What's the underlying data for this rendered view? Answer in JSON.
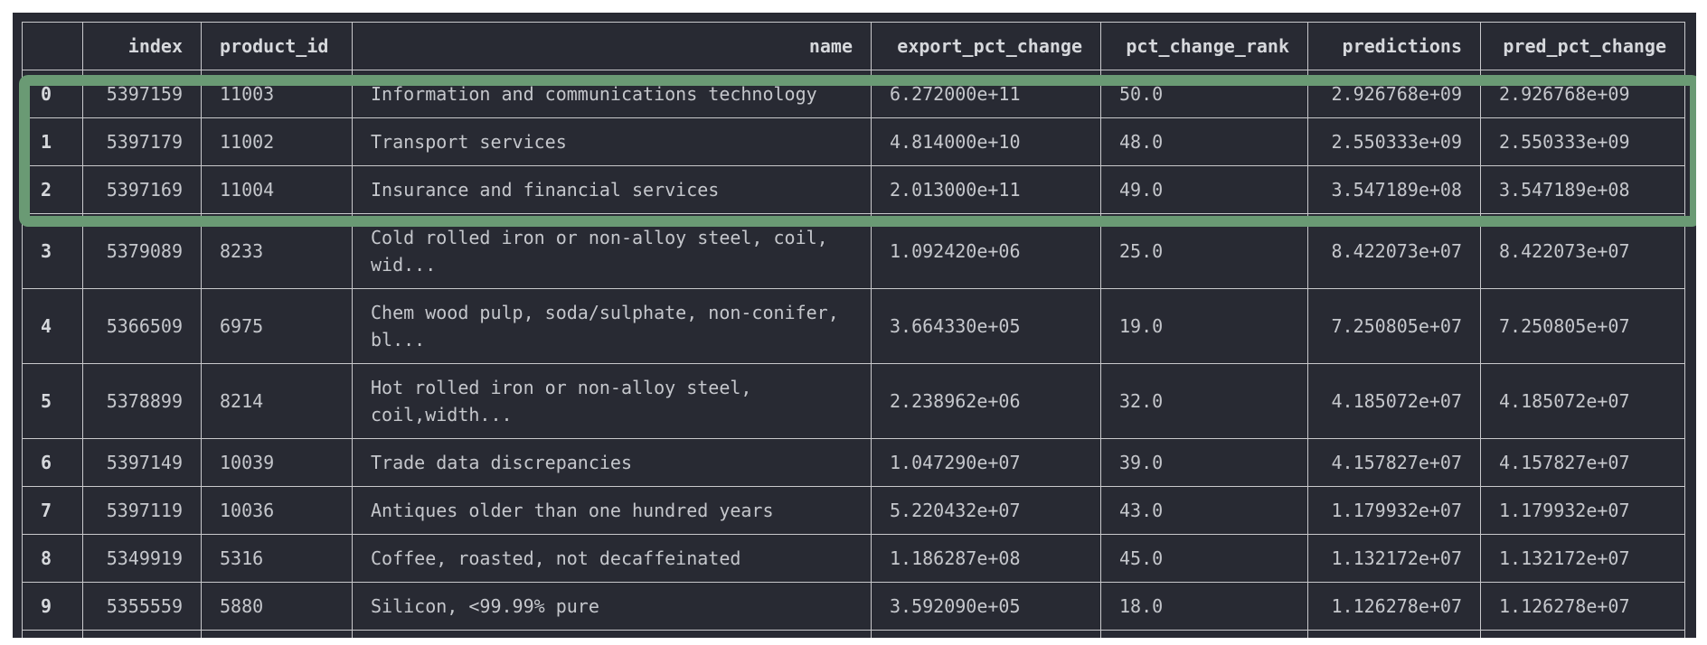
{
  "table": {
    "columns": [
      "",
      "index",
      "product_id",
      "name",
      "export_pct_change",
      "pct_change_rank",
      "predictions",
      "pred_pct_change"
    ],
    "rows": [
      {
        "row": "0",
        "index": "5397159",
        "product_id": "11003",
        "name": "Information and communications technology",
        "export_pct_change": "6.272000e+11",
        "pct_change_rank": "50.0",
        "predictions": "2.926768e+09",
        "pred_pct_change": "2.926768e+09"
      },
      {
        "row": "1",
        "index": "5397179",
        "product_id": "11002",
        "name": "Transport services",
        "export_pct_change": "4.814000e+10",
        "pct_change_rank": "48.0",
        "predictions": "2.550333e+09",
        "pred_pct_change": "2.550333e+09"
      },
      {
        "row": "2",
        "index": "5397169",
        "product_id": "11004",
        "name": "Insurance and financial services",
        "export_pct_change": "2.013000e+11",
        "pct_change_rank": "49.0",
        "predictions": "3.547189e+08",
        "pred_pct_change": "3.547189e+08"
      },
      {
        "row": "3",
        "index": "5379089",
        "product_id": "8233",
        "name": "Cold rolled iron or non-alloy steel, coil, wid...",
        "export_pct_change": "1.092420e+06",
        "pct_change_rank": "25.0",
        "predictions": "8.422073e+07",
        "pred_pct_change": "8.422073e+07"
      },
      {
        "row": "4",
        "index": "5366509",
        "product_id": "6975",
        "name": "Chem wood pulp, soda/sulphate, non-conifer, bl...",
        "export_pct_change": "3.664330e+05",
        "pct_change_rank": "19.0",
        "predictions": "7.250805e+07",
        "pred_pct_change": "7.250805e+07"
      },
      {
        "row": "5",
        "index": "5378899",
        "product_id": "8214",
        "name": "Hot rolled iron or non-alloy steel, coil,width...",
        "export_pct_change": "2.238962e+06",
        "pct_change_rank": "32.0",
        "predictions": "4.185072e+07",
        "pred_pct_change": "4.185072e+07"
      },
      {
        "row": "6",
        "index": "5397149",
        "product_id": "10039",
        "name": "Trade data discrepancies",
        "export_pct_change": "1.047290e+07",
        "pct_change_rank": "39.0",
        "predictions": "4.157827e+07",
        "pred_pct_change": "4.157827e+07"
      },
      {
        "row": "7",
        "index": "5397119",
        "product_id": "10036",
        "name": "Antiques older than one hundred years",
        "export_pct_change": "5.220432e+07",
        "pct_change_rank": "43.0",
        "predictions": "1.179932e+07",
        "pred_pct_change": "1.179932e+07"
      },
      {
        "row": "8",
        "index": "5349919",
        "product_id": "5316",
        "name": "Coffee, roasted, not decaffeinated",
        "export_pct_change": "1.186287e+08",
        "pct_change_rank": "45.0",
        "predictions": "1.132172e+07",
        "pred_pct_change": "1.132172e+07"
      },
      {
        "row": "9",
        "index": "5355559",
        "product_id": "5880",
        "name": "Silicon, <99.99% pure",
        "export_pct_change": "3.592090e+05",
        "pct_change_rank": "18.0",
        "predictions": "1.126278e+07",
        "pred_pct_change": "1.126278e+07"
      }
    ]
  },
  "highlight": {
    "rows": [
      "0",
      "1",
      "2"
    ],
    "color": "#6a9a74"
  },
  "colors": {
    "background": "#282a33",
    "text": "#c5c7cc",
    "grid": "#c9c9cc"
  }
}
